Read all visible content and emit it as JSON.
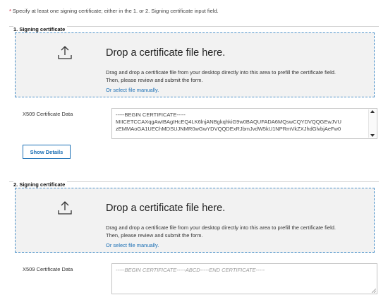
{
  "notice": {
    "asterisk": "*",
    "text": "Specify at least one signing certificate; either in the 1. or 2. Signing certificate input field."
  },
  "certificates": [
    {
      "title": "1. Signing certificate",
      "dropzone": {
        "icon": "upload-icon",
        "title": "Drop a certificate file here.",
        "desc_line1": "Drag and drop a certificate file from your desktop directly into this area to prefill the certificate field.",
        "desc_line2": "Then, please review and submit the form.",
        "link": "Or select file manually."
      },
      "field_label": "X509 Certificate Data",
      "value_lines": [
        "-----BEGIN CERTIFICATE-----",
        "MIICETCCAXqgAwIBAgIHcEQ4LK6lnjANBgkqhkiG9w0BAQUFADA6MQswCQYDVQQGEwJVU",
        "zEMMAoGA1UEChMDSUJNMR0wGwYDVQQDExRJbmJvdW5kU1NPRmVkZXJhdGlvbjAeFw0"
      ],
      "button": "Show Details"
    },
    {
      "title": "2. Signing certificate",
      "dropzone": {
        "icon": "upload-icon",
        "title": "Drop a certificate file here.",
        "desc_line1": "Drag and drop a certificate file from your desktop directly into this area to prefill the certificate field.",
        "desc_line2": "Then, please review and submit the form.",
        "link": "Or select file manually."
      },
      "field_label": "X509 Certificate Data",
      "placeholder": "-----BEGIN CERTIFICATE-----ABCD-----END CERTIFICATE-----"
    }
  ],
  "colors": {
    "accent": "#1a6fb5",
    "dashed_border": "#4a90c8",
    "dropzone_bg": "#f2f2f2",
    "required": "#d0021b"
  }
}
